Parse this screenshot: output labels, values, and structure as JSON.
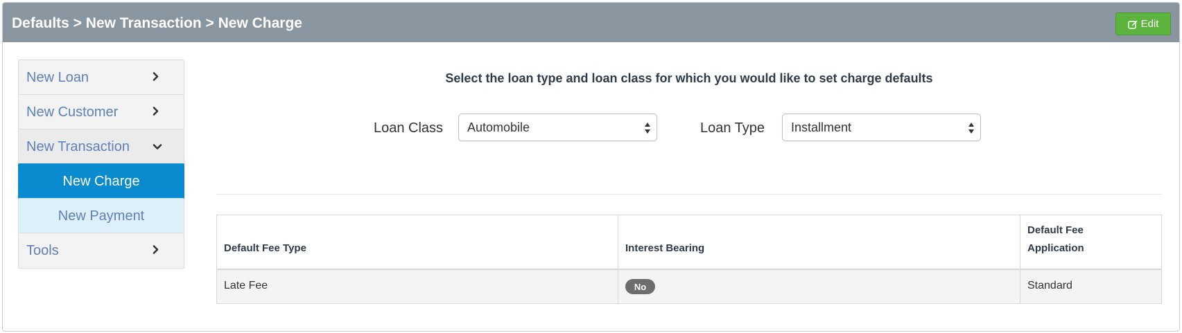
{
  "header": {
    "breadcrumb": "Defaults > New Transaction > New Charge",
    "edit_label": "Edit",
    "edit_icon": "pencil-square-icon"
  },
  "sidebar": {
    "items": [
      {
        "label": "New Loan",
        "icon": "chevron-right-icon",
        "state": "collapsed"
      },
      {
        "label": "New Customer",
        "icon": "chevron-right-icon",
        "state": "collapsed"
      },
      {
        "label": "New Transaction",
        "icon": "chevron-down-icon",
        "state": "expanded"
      },
      {
        "label": "New Charge",
        "state": "active"
      },
      {
        "label": "New Payment",
        "state": "sub-item"
      },
      {
        "label": "Tools",
        "icon": "chevron-right-icon",
        "state": "collapsed"
      }
    ]
  },
  "main": {
    "heading": "Select the loan type and loan class for which you would like to set charge defaults",
    "loan_class": {
      "label": "Loan Class",
      "value": "Automobile"
    },
    "loan_type": {
      "label": "Loan Type",
      "value": "Installment"
    }
  },
  "table": {
    "headers": [
      "Default Fee Type",
      "Interest Bearing",
      "Default Fee Application"
    ],
    "rows": [
      {
        "fee_type": "Late Fee",
        "interest_bearing": "No",
        "application": "Standard"
      }
    ]
  },
  "colors": {
    "header_bg": "#8a969f",
    "edit_button": "#5cb43e",
    "active_nav": "#0a8acf",
    "link_text": "#5f80b8",
    "badge": "#6d6d6d"
  }
}
